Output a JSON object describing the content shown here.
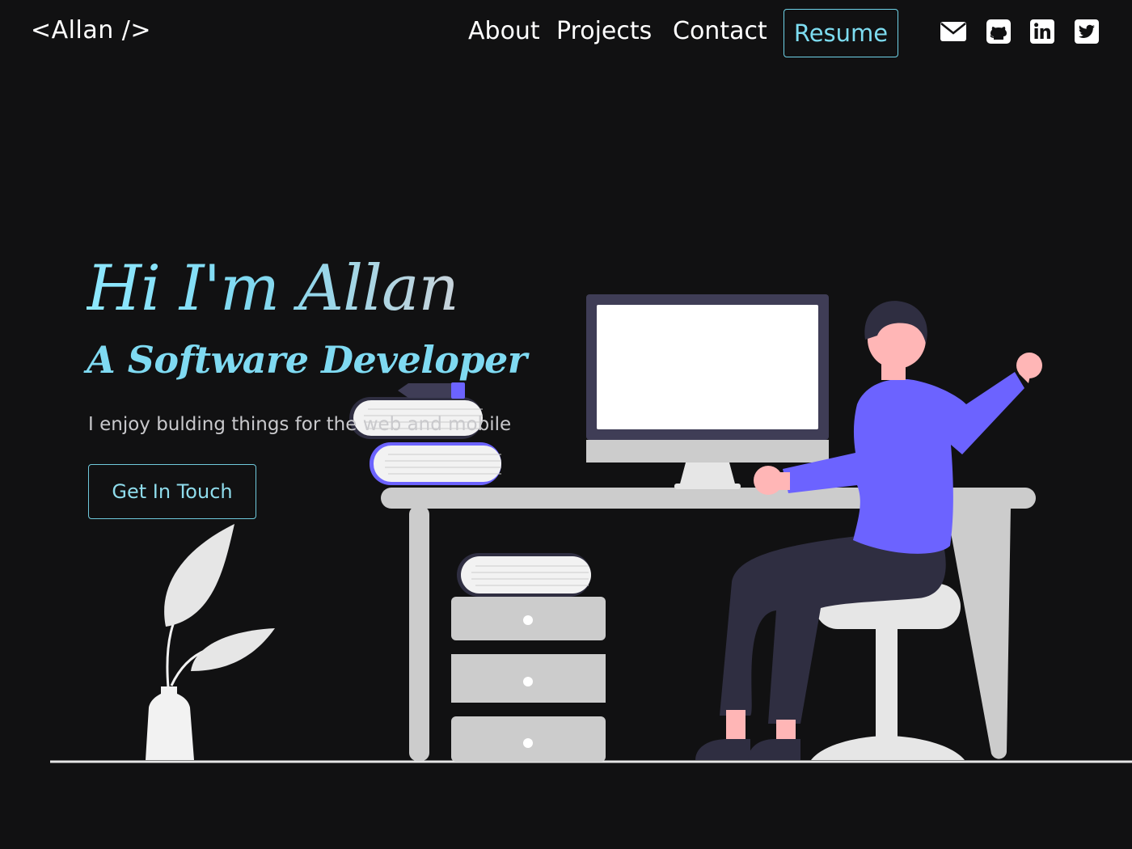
{
  "header": {
    "logo": "<Allan />",
    "nav": [
      {
        "label": "About"
      },
      {
        "label": "Projects"
      },
      {
        "label": "Contact"
      }
    ],
    "resume_label": "Resume",
    "social_icons": [
      "envelope-icon",
      "github-icon",
      "linkedin-icon",
      "twitter-icon"
    ]
  },
  "hero": {
    "title": "Hi I'm Allan",
    "subtitle": "A Software Developer",
    "tagline": "I enjoy bulding things for the web and mobile",
    "cta_label": "Get In Touch"
  },
  "colors": {
    "background": "#111112",
    "accent": "#7fdaf2",
    "person_shirt": "#6c63ff",
    "dark_navy": "#2f2e41",
    "skin": "#ffb6b6",
    "light_gray": "#cccccc"
  }
}
